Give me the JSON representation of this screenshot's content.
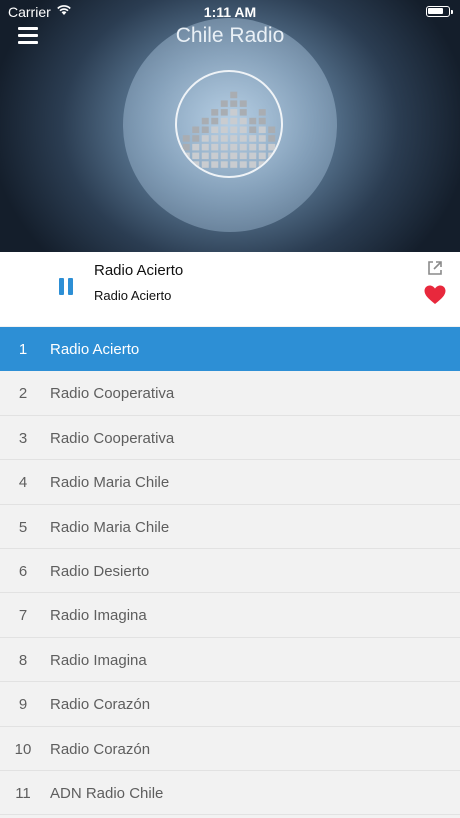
{
  "status_bar": {
    "carrier": "Carrier",
    "time": "1:11 AM"
  },
  "header": {
    "title": "Chile Radio"
  },
  "now_playing": {
    "title": "Radio Acierto",
    "subtitle": "Radio Acierto"
  },
  "colors": {
    "accent": "#2d8fd5",
    "heart": "#e8283c"
  },
  "stations": [
    {
      "num": "1",
      "name": "Radio Acierto",
      "active": true
    },
    {
      "num": "2",
      "name": "Radio Cooperativa"
    },
    {
      "num": "3",
      "name": "Radio Cooperativa"
    },
    {
      "num": "4",
      "name": "Radio Maria Chile"
    },
    {
      "num": "5",
      "name": "Radio Maria Chile"
    },
    {
      "num": "6",
      "name": "Radio Desierto"
    },
    {
      "num": "7",
      "name": "Radio Imagina"
    },
    {
      "num": "8",
      "name": "Radio Imagina"
    },
    {
      "num": "9",
      "name": "Radio Corazón"
    },
    {
      "num": "10",
      "name": "Radio Corazón"
    },
    {
      "num": "11",
      "name": "ADN Radio Chile"
    }
  ]
}
